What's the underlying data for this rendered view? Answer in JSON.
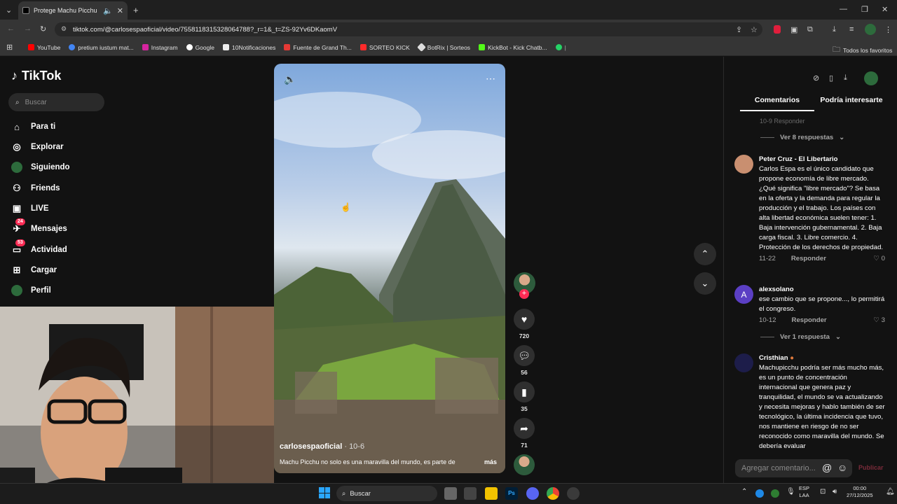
{
  "browser": {
    "tab_title": "Protege Machu Picchu Un",
    "url": "tiktok.com/@carlosespaoficial/video/7558118315328064788?_r=1&_t=ZS-92Yv6DKaomV",
    "bookmarks": [
      "YouTube",
      "pretium iustum mat...",
      "Instagram",
      "Google",
      "10Notificaciones",
      "Fuente de Grand Th...",
      "SORTEO KICK",
      "BotRix | Sorteos",
      "KickBot - Kick Chatb..."
    ],
    "bookmarks_right": "Todos los favoritos"
  },
  "tiktok": {
    "logo": "TikTok",
    "search_placeholder": "Buscar",
    "nav": [
      {
        "label": "Para ti",
        "icon": "home-icon"
      },
      {
        "label": "Explorar",
        "icon": "compass-icon"
      },
      {
        "label": "Siguiendo",
        "icon": "following-icon"
      },
      {
        "label": "Friends",
        "icon": "friends-icon"
      },
      {
        "label": "LIVE",
        "icon": "live-icon"
      },
      {
        "label": "Mensajes",
        "icon": "messages-icon",
        "badge": "24"
      },
      {
        "label": "Actividad",
        "icon": "activity-icon",
        "badge": "53"
      },
      {
        "label": "Cargar",
        "icon": "upload-icon"
      },
      {
        "label": "Perfil",
        "icon": "profile-icon"
      }
    ]
  },
  "video": {
    "author": "carlosespaoficial",
    "date": "· 10-6",
    "caption": "Machu Picchu no solo es una maravilla del mundo, es parte de",
    "more": "más",
    "likes": "720",
    "comments": "56",
    "saves": "35",
    "shares": "71"
  },
  "comments_panel": {
    "tab_comments": "Comentarios",
    "tab_related": "Podría interesarte",
    "top_meta": "10-9   Responder",
    "view_replies_1": "Ver 8 respuestas",
    "comments": [
      {
        "author": "Peter Cruz - El Libertario",
        "text": "Carlos Espa es el único candidato que propone economía de libre mercado. ¿Qué significa \"libre mercado\"? Se basa en la oferta y la demanda para regular la producción y el trabajo. Los países con alta libertad económica suelen tener: 1. Baja intervención gubernamental. 2. Baja carga fiscal. 3. Libre comercio. 4. Protección de los derechos de propiedad.",
        "date": "11-22",
        "reply": "Responder",
        "likes": "0"
      },
      {
        "author": "alexsolano",
        "text": "ese cambio que se propone..., lo permitirá el congreso.",
        "date": "10-12",
        "reply": "Responder",
        "likes": "3"
      },
      {
        "author": "Cristhian",
        "text": "Machupicchu podría ser más mucho más, es un punto de concentración internacional que genera paz y tranquilidad, el mundo se va actualizando y necesita mejoras y hablo también de ser tecnológico, la última incidencia que tuvo, nos mantiene en riesgo de no ser reconocido como maravilla del mundo. Se debería evaluar"
      }
    ],
    "view_replies_2": "Ver 1 respuesta",
    "input_placeholder": "Agregar comentario...",
    "publish": "Publicar"
  },
  "taskbar": {
    "search": "Buscar",
    "lang": "ESP",
    "lang2": "LAA",
    "time": "00:00",
    "date": "27/12/2025"
  }
}
